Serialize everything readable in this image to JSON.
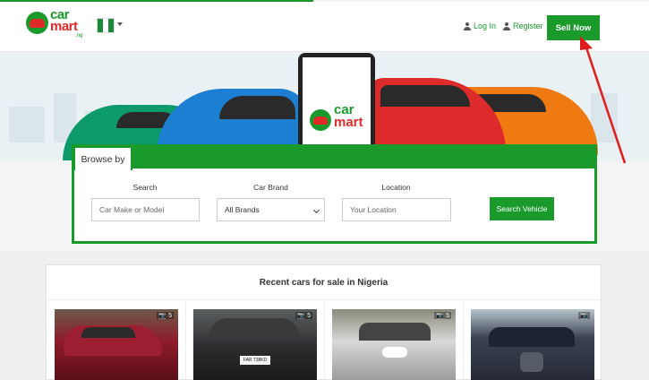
{
  "header": {
    "logo_line1": "car",
    "logo_line2": "mart",
    "logo_suffix": ".ng",
    "country_flag": "nigeria-flag",
    "login_label": "Log In",
    "register_label": "Register",
    "sell_button_label": "Sell Now"
  },
  "hero": {
    "phone_logo_line1": "car",
    "phone_logo_line2": "mart"
  },
  "browse": {
    "tab_label": "Browse by",
    "search_label": "Search",
    "search_placeholder": "Car Make or Model",
    "brand_label": "Car Brand",
    "brand_selected": "All Brands",
    "location_label": "Location",
    "location_placeholder": "Your Location",
    "search_button_label": "Search Vehicle"
  },
  "recent": {
    "title": "Recent cars for sale in Nigeria",
    "items": [
      {
        "photo_count": "5",
        "color": "#8e1b2a"
      },
      {
        "photo_count": "5",
        "color": "#2b2b2e",
        "plate": "FAR 738KD"
      },
      {
        "photo_count": "5",
        "color": "#d8d8d8"
      },
      {
        "photo_count": "",
        "color": "#3a4152"
      }
    ]
  },
  "colors": {
    "brand_green": "#1a9a2b",
    "brand_red": "#e02a2a",
    "annotation_arrow": "#e01b1b"
  }
}
